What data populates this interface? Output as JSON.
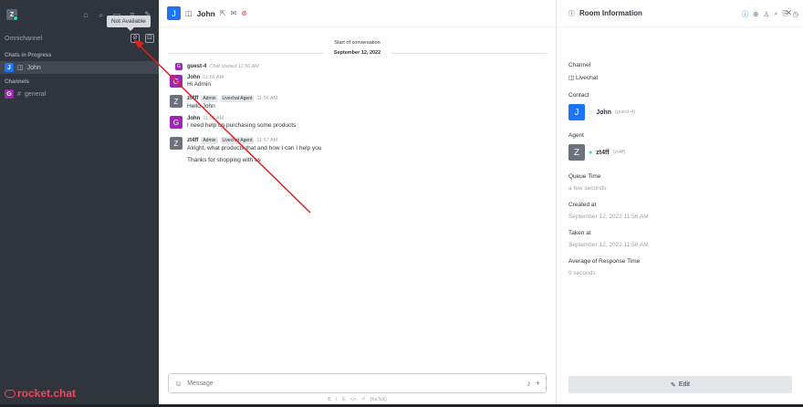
{
  "sidebar": {
    "workspace_letter": "Z",
    "tooltip": "Not Available",
    "omnichannel_title": "Omnichannel",
    "sections": [
      {
        "title": "Chats in Progress",
        "rooms": [
          {
            "letter": "J",
            "name": "John",
            "color": "#1d74f5",
            "active": true,
            "icon": "livechat-icon"
          }
        ]
      },
      {
        "title": "Channels",
        "rooms": [
          {
            "letter": "G",
            "name": "general",
            "color": "#9c27b0",
            "active": false,
            "icon": "hash-icon"
          }
        ]
      }
    ],
    "brand": "rocket.chat"
  },
  "header": {
    "avatar_letter": "J",
    "room_name": "John",
    "avatar_color": "#1d74f5"
  },
  "conversation": {
    "start_text": "Start of conversation",
    "date": "September 12, 2022",
    "messages": [
      {
        "avatar": "G",
        "color": "#9c27b0",
        "user": "guest-4",
        "time": "Chat started  11:56 AM",
        "body": "",
        "system": true,
        "badges": []
      },
      {
        "avatar": "G",
        "color": "#9c27b0",
        "user": "John",
        "time": "11:56 AM",
        "body": "Hi Admin",
        "badges": []
      },
      {
        "avatar": "Z",
        "color": "#6c727a",
        "user": "zt4ff",
        "time": "11:56 AM",
        "body": "Hello John",
        "badges": [
          "Admin",
          "Livechat Agent"
        ]
      },
      {
        "avatar": "G",
        "color": "#9c27b0",
        "user": "John",
        "time": "11:56 AM",
        "body": "I need help on purchasing some products",
        "badges": []
      },
      {
        "avatar": "Z",
        "color": "#6c727a",
        "user": "zt4ff",
        "time": "11:57 AM",
        "body": "Alright, what products that and how I can I help you",
        "badges": [
          "Admin",
          "Livechat Agent"
        ]
      },
      {
        "avatar": "",
        "color": "",
        "user": "",
        "time": "",
        "body": "Thanks for shopping with us",
        "badges": [],
        "continuation": true
      }
    ]
  },
  "composer": {
    "placeholder": "Message",
    "format_hints": "B  I  S  </>  ⏎  {KaTeX}"
  },
  "room_info": {
    "title": "Room Information",
    "channel_label": "Channel",
    "channel_value": "Livechat",
    "contact_label": "Contact",
    "contact_letter": "J",
    "contact_name": "John",
    "contact_user": "(guest-4)",
    "agent_label": "Agent",
    "agent_letter": "Z",
    "agent_name": "zt4ff",
    "agent_user": "(zt4ff)",
    "queue_label": "Queue Time",
    "queue_value": "a few seconds",
    "created_label": "Created at",
    "created_value": "September 12, 2022 11:56 AM",
    "taken_label": "Taken at",
    "taken_value": "September 12, 2022 11:56 AM",
    "avg_label": "Average of Response Time",
    "avg_value": "9 seconds",
    "edit_label": "Edit"
  },
  "colors": {
    "sidebar_bg": "#2f343d",
    "accent": "#1d74f5",
    "brand_red": "#f5455c",
    "online": "#2de0a5",
    "annotation_arrow": "#e0201b"
  }
}
